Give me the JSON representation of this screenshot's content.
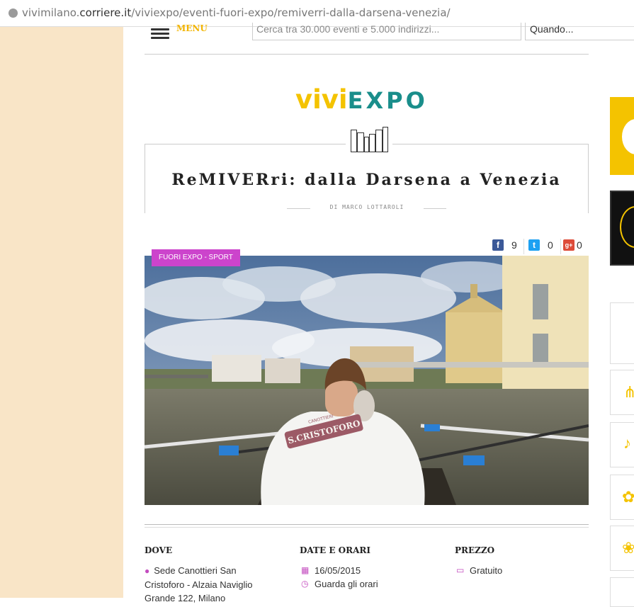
{
  "browser": {
    "url_prefix": "vivimilano.",
    "url_domain": "corriere.it",
    "url_path": "/viviexpo/eventi-fuori-expo/remiverri-dalla-darsena-venezia/"
  },
  "nav": {
    "menu_label": "MENU",
    "search_placeholder": "Cerca tra 30.000 eventi e 5.000 indirizzi...",
    "when_placeholder": "Quando..."
  },
  "logo": {
    "vivi": "vivi",
    "expo": "EXPO"
  },
  "article": {
    "title": "ReMIVERri: dalla Darsena a Venezia",
    "author": "DI MARCO LOTTAROLI",
    "category": "FUORI EXPO - SPORT"
  },
  "shares": {
    "facebook": "9",
    "twitter": "0",
    "googleplus": "0"
  },
  "info": {
    "dove_label": "DOVE",
    "dove_value": "Sede Canottieri San Cristoforo - Alzaia Naviglio Grande 122, Milano",
    "date_label": "DATE E ORARI",
    "date_value": "16/05/2015",
    "hours_link": "Guarda gli orari",
    "price_label": "PREZZO",
    "price_value": "Gratuito"
  },
  "photo": {
    "shirt_text": "S.CRISTOFORO",
    "shirt_top": "CANOTTIERI"
  },
  "colors": {
    "accent_yellow": "#f4c300",
    "accent_teal": "#1a8e8b",
    "badge": "#cc44cc",
    "page_bg": "#f9e5c7"
  },
  "icons": [
    "globe-icon",
    "menu-icon",
    "books-icon",
    "facebook-icon",
    "twitter-icon",
    "googleplus-icon",
    "location-pin-icon",
    "calendar-icon",
    "clock-icon",
    "wallet-icon"
  ]
}
